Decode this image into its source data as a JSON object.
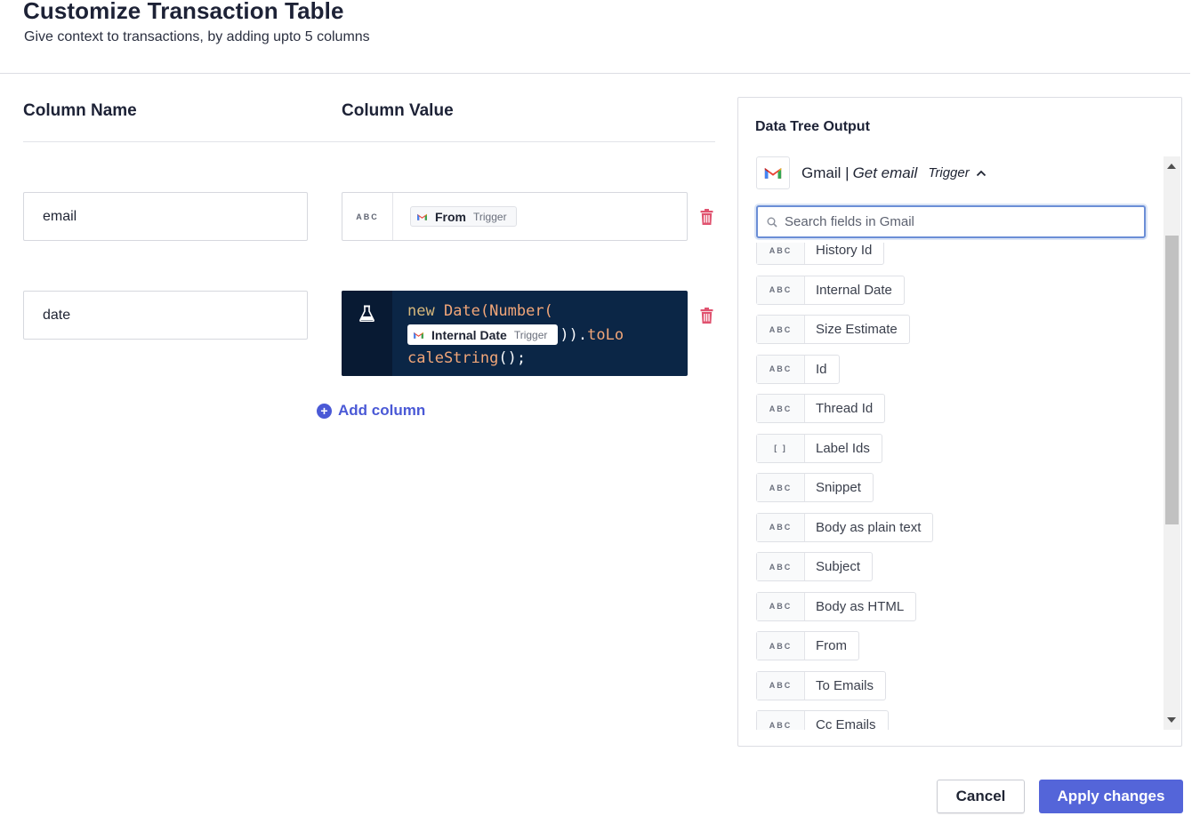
{
  "header": {
    "title": "Customize Transaction Table",
    "subtitle": "Give context to transactions, by adding upto 5 columns"
  },
  "columns_header": {
    "name": "Column Name",
    "value": "Column Value"
  },
  "rows": [
    {
      "name": "email",
      "type": "ABC",
      "pill_label": "From",
      "pill_tag": "Trigger"
    },
    {
      "name": "date",
      "code": {
        "line1_kw": "new",
        "line1_rest": "Date(Number(",
        "pill_label": "Internal Date",
        "pill_tag": "Trigger",
        "line2_punct": ")).",
        "line2_fn": "toLo",
        "line3_fn": "caleString",
        "line3_punct": "();"
      }
    }
  ],
  "add_column_label": "Add column",
  "panel": {
    "title": "Data Tree Output",
    "app_name": "Gmail",
    "separator": "|",
    "action": "Get email",
    "trigger": "Trigger",
    "search_placeholder": "Search fields in Gmail",
    "fields": [
      {
        "type": "ABC",
        "label": "History Id"
      },
      {
        "type": "ABC",
        "label": "Internal Date"
      },
      {
        "type": "ABC",
        "label": "Size Estimate"
      },
      {
        "type": "ABC",
        "label": "Id"
      },
      {
        "type": "ABC",
        "label": "Thread Id"
      },
      {
        "type": "[ ]",
        "label": "Label Ids"
      },
      {
        "type": "ABC",
        "label": "Snippet"
      },
      {
        "type": "ABC",
        "label": "Body as plain text"
      },
      {
        "type": "ABC",
        "label": "Subject"
      },
      {
        "type": "ABC",
        "label": "Body as HTML"
      },
      {
        "type": "ABC",
        "label": "From"
      },
      {
        "type": "ABC",
        "label": "To Emails"
      },
      {
        "type": "ABC",
        "label": "Cc Emails"
      }
    ]
  },
  "footer": {
    "cancel_label": "Cancel",
    "apply_label": "Apply changes"
  },
  "colors": {
    "primary": "#5465d9",
    "link": "#4a59d6",
    "code_bg": "#0b2646",
    "trash": "#e0526f"
  },
  "icons": [
    "gmail-icon",
    "trash-icon",
    "flask-icon",
    "plus-circle-icon",
    "search-icon",
    "chevron-up-icon"
  ]
}
